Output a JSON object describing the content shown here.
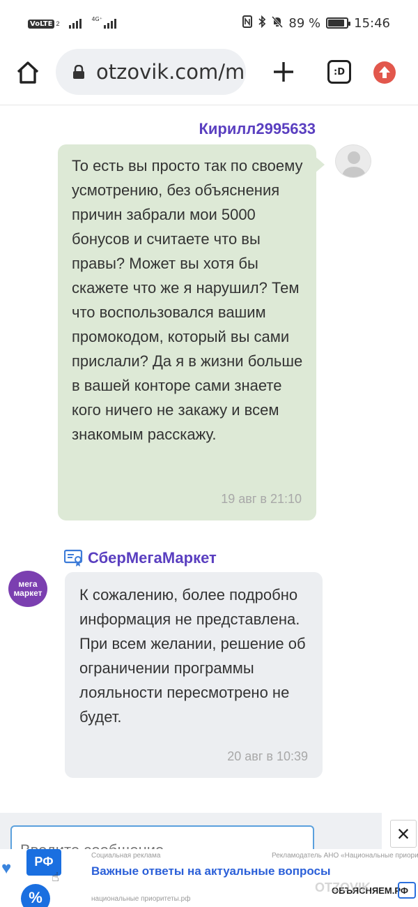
{
  "status_bar": {
    "volte": "VoLTE",
    "volte_sub": "2",
    "network_type": "4G⁺",
    "battery_text": "89 %",
    "battery_level": 0.89,
    "time": "15:46"
  },
  "browser": {
    "url": "otzovik.com/m",
    "tabs_label": ":D"
  },
  "messages": [
    {
      "author": "Кирилл2995633",
      "text": "То есть вы просто так по своему усмотрению, без объяснения причин забрали мои 5000 бонусов и считаете что вы правы? Может вы хотя бы скажете что же я нарушил? Тем что воспользовался вашим промокодом, который вы сами прислали? Да я в жизни больше в вашей конторе сами знаете кого ничего не закажу и всем знакомым расскажу.",
      "time": "19 авг в 21:10"
    },
    {
      "author": "СберМегаМаркет",
      "avatar_text": "мега маркет",
      "text": "К сожалению, более подробно информация не представлена. При всем желании, решение об ограничении программы лояльности пересмотрено не будет.",
      "time": "20 авг в 10:39"
    }
  ],
  "composer": {
    "placeholder": "Введите сообщение"
  },
  "ad": {
    "rf_badge": "РФ",
    "social_label": "Социальная реклама",
    "advertiser": "Рекламодатель АНО «Национальные приоритеты»",
    "title": "Важные ответы на актуальные вопросы",
    "site": "национальные приоритеты.рф",
    "brand": "ОБЪЯСНЯЕМ.РФ"
  },
  "watermark": "OTZOVIK",
  "colors": {
    "author": "#5a3fc0",
    "user_bubble": "#dde9d6",
    "shop_bubble": "#eceef1",
    "ad_blue": "#1a6fe0"
  }
}
